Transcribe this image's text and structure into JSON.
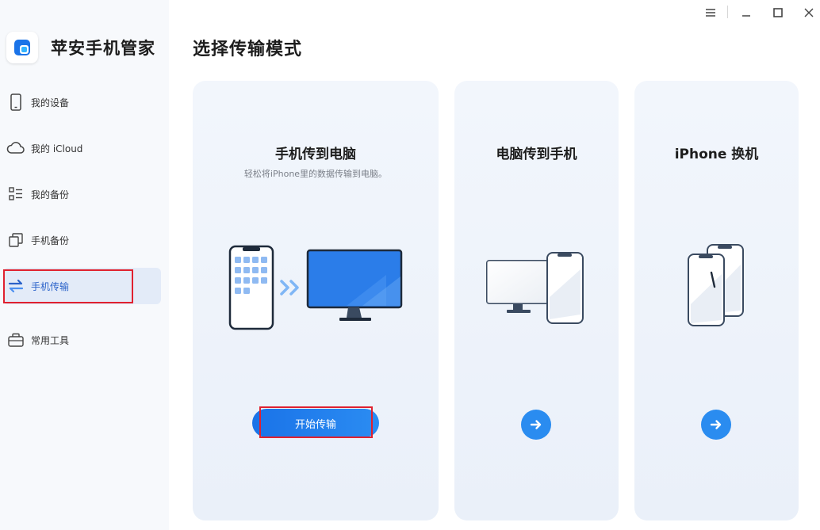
{
  "app": {
    "name": "苹安手机管家"
  },
  "sidebar": {
    "items": [
      {
        "label": "我的设备",
        "icon": "phone-icon",
        "active": false
      },
      {
        "label": "我的 iCloud",
        "icon": "cloud-icon",
        "active": false
      },
      {
        "label": "我的备份",
        "icon": "backup-list-icon",
        "active": false
      },
      {
        "label": "手机备份",
        "icon": "copy-icon",
        "active": false
      },
      {
        "label": "手机传输",
        "icon": "transfer-icon",
        "active": true
      },
      {
        "label": "常用工具",
        "icon": "toolbox-icon",
        "active": false
      }
    ]
  },
  "main": {
    "title": "选择传输模式",
    "cards": [
      {
        "title": "手机传到电脑",
        "subtitle": "轻松将iPhone里的数据传输到电脑。",
        "button": "开始传输"
      },
      {
        "title": "电脑传到手机"
      },
      {
        "title": "iPhone 换机"
      }
    ]
  },
  "colors": {
    "accent": "#2a8cf0",
    "highlight": "#e0212f",
    "active_bg": "#e3ebf8"
  }
}
